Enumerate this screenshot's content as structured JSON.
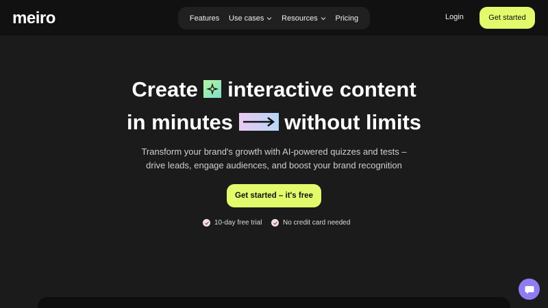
{
  "header": {
    "logo": "meiro",
    "nav": [
      {
        "label": "Features",
        "has_dropdown": false
      },
      {
        "label": "Use cases",
        "has_dropdown": true
      },
      {
        "label": "Resources",
        "has_dropdown": true
      },
      {
        "label": "Pricing",
        "has_dropdown": false
      }
    ],
    "login_label": "Login",
    "cta_label": "Get started"
  },
  "hero": {
    "line1_before": "Create",
    "line1_after": "interactive content",
    "line2_before": "in minutes",
    "line2_after": "without limits",
    "subtitle_line1": "Transform your brand's growth with AI-powered quizzes and tests –",
    "subtitle_line2": "drive leads, engage audiences, and boost your brand recognition",
    "cta_label": "Get started – it's free",
    "perks": [
      "10-day free trial",
      "No credit card needed"
    ]
  },
  "icons": {
    "sparkle_tile": "sparkle-icon",
    "arrow_tile": "arrow-right-icon",
    "check": "check-circle-icon",
    "chat": "chat-icon",
    "chevron": "chevron-down-icon"
  },
  "colors": {
    "accent": "#e2fb6c",
    "background": "#1b1b1b",
    "chat_bubble": "#8e7cf0"
  }
}
